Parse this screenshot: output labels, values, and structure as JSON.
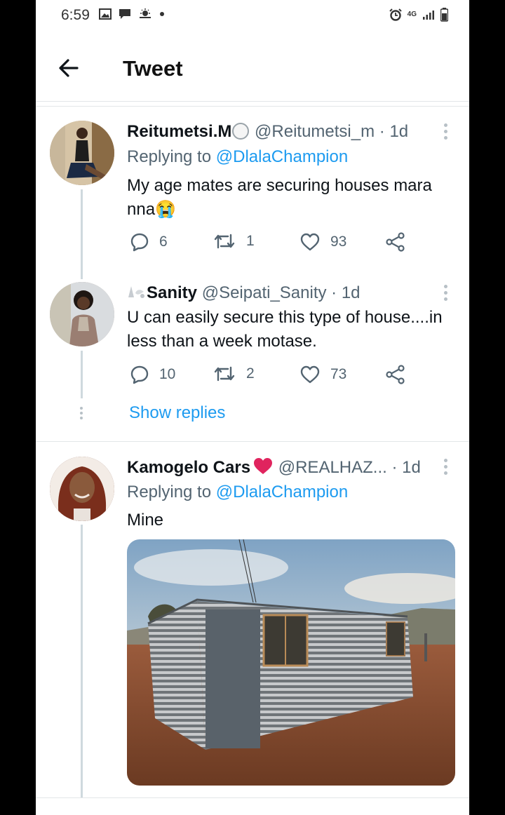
{
  "status_bar": {
    "time": "6:59",
    "network": "4G"
  },
  "header": {
    "title": "Tweet"
  },
  "tweets": [
    {
      "display_name": "Reitumetsi.M",
      "handle": "@Reitumetsi_m",
      "time": "· 1d",
      "replying_prefix": "Replying to",
      "replying_to": "@DlalaChampion",
      "text": "My age mates are securing houses mara nna😭",
      "replies": "6",
      "retweets": "1",
      "likes": "93"
    },
    {
      "display_name": "Sanity",
      "handle": "@Seipati_Sanity",
      "time": "· 1d",
      "text": "U can easily secure this type of house....in less than a week motase.",
      "replies": "10",
      "retweets": "2",
      "likes": "73",
      "show_replies": "Show replies"
    },
    {
      "display_name": "Kamogelo Cars",
      "handle": "@REALHAZ...",
      "time": "· 1d",
      "replying_prefix": "Replying to",
      "replying_to": "@DlalaChampion",
      "text": "Mine"
    }
  ],
  "colors": {
    "link": "#1d9bf0",
    "secondary_text": "#536471",
    "primary_text": "#0f1419",
    "heart": "#e0245e"
  }
}
